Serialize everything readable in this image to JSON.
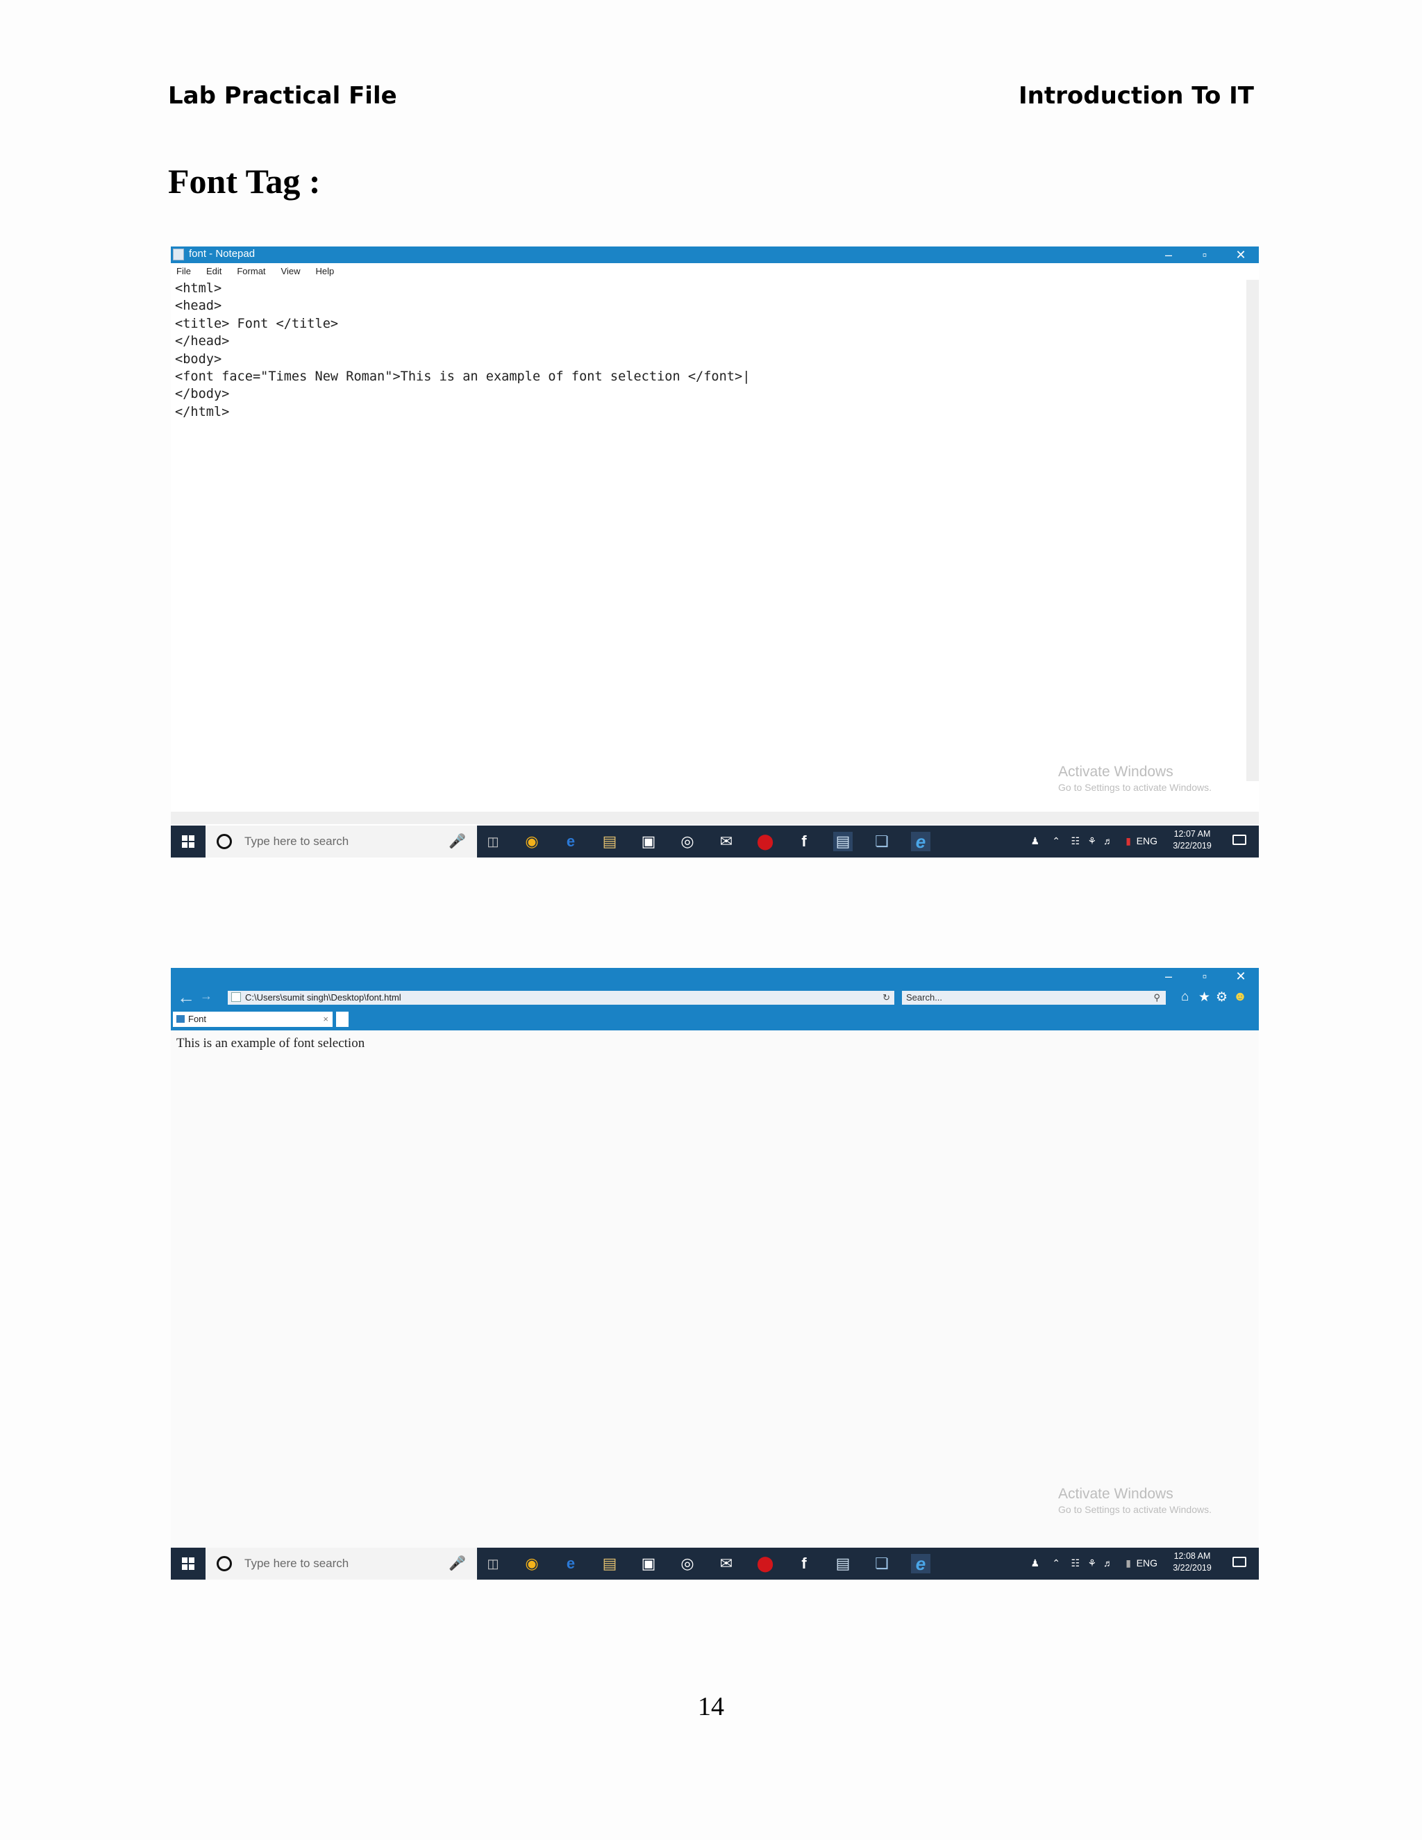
{
  "header": {
    "left": "Lab Practical File",
    "right": "Introduction To IT"
  },
  "section_title": "Font Tag :",
  "notepad": {
    "window_title": "font - Notepad",
    "window_controls": [
      "–",
      "▫",
      "✕"
    ],
    "menu": [
      "File",
      "Edit",
      "Format",
      "View",
      "Help"
    ],
    "code_lines": [
      "<html>",
      "<head>",
      "<title> Font </title>",
      "</head>",
      "<body>",
      "<font face=\"Times New Roman\">This is an example of font selection </font>|",
      "</body>",
      "</html>"
    ],
    "watermark": {
      "line1": "Activate Windows",
      "line2": "Go to Settings to activate Windows."
    }
  },
  "taskbar_1": {
    "search_placeholder": "Type here to search",
    "language": "ENG",
    "time": "12:07 AM",
    "date": "3/22/2019"
  },
  "browser": {
    "window_controls": [
      "–",
      "▫",
      "✕"
    ],
    "address": "C:\\Users\\sumit singh\\Desktop\\font.html",
    "search_placeholder": "Search...",
    "tab_title": "Font",
    "content_text": "This is an example of font selection",
    "watermark": {
      "line1": "Activate Windows",
      "line2": "Go to Settings to activate Windows."
    }
  },
  "taskbar_2": {
    "search_placeholder": "Type here to search",
    "language": "ENG",
    "time": "12:08 AM",
    "date": "3/22/2019"
  },
  "page_number": "14",
  "colors": {
    "titlebar_blue": "#1b84c6",
    "taskbar_dark": "#1c2b3e"
  },
  "taskbar_icon_names": [
    "task-view-icon",
    "chrome-icon",
    "edge-icon",
    "file-explorer-icon",
    "store-icon",
    "groove-icon",
    "mail-icon",
    "opera-icon",
    "facebook-icon",
    "notepad-app-icon",
    "files-icon",
    "internet-explorer-icon"
  ]
}
